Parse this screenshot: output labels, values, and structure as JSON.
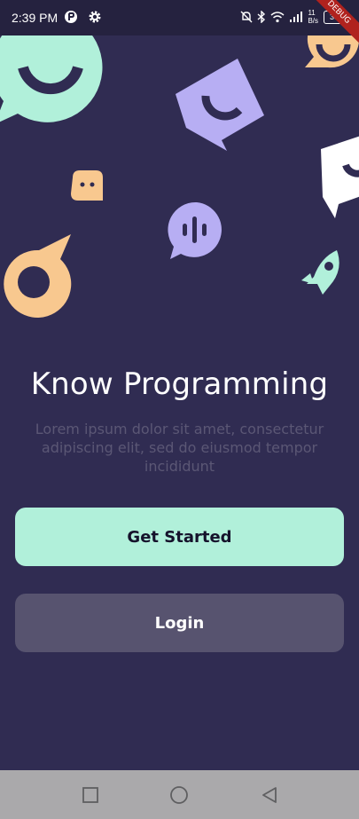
{
  "status_bar": {
    "time": "2:39 PM",
    "speed_top": "11",
    "speed_bottom": "B/s",
    "battery": "38"
  },
  "debug_banner": "DEBUG",
  "welcome": {
    "title": "Know Programming",
    "subtitle": "Lorem ipsum dolor sit amet, consectetur adipiscing elit, sed do eiusmod tempor incididunt"
  },
  "buttons": {
    "get_started": "Get Started",
    "login": "Login"
  },
  "colors": {
    "background": "#302c52",
    "mint": "#b1f0da",
    "lavender": "#b7aef3",
    "peach": "#f8c88f",
    "white": "#ffffff",
    "login_button": "#57536f"
  },
  "icons": [
    "smile-bubble-icon",
    "wink-pentagon-icon",
    "dots-bubble-icon",
    "voice-bubble-icon",
    "ring-drop-icon",
    "rocket-icon",
    "chat-arrow-icon"
  ]
}
